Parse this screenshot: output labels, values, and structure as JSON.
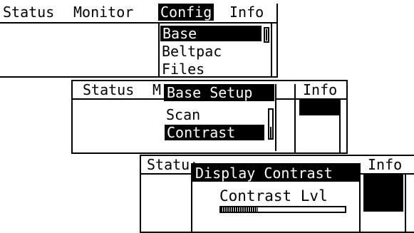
{
  "colors": {
    "foreground": "#000000",
    "background": "#ffffff"
  },
  "screen1": {
    "menubar": {
      "status": "Status",
      "monitor": "Monitor",
      "config": "Config",
      "info": "Info"
    },
    "config_menu": {
      "items": [
        "Base",
        "Beltpac",
        "Files"
      ],
      "selected": "Base"
    }
  },
  "screen2": {
    "menubar": {
      "status": "Status",
      "monitor_partial": "M",
      "info": "Info"
    },
    "base_setup_menu": {
      "title": "Base Setup",
      "items": [
        "Scan",
        "Contrast"
      ],
      "selected": "Contrast"
    }
  },
  "screen3": {
    "menubar": {
      "status_partial": "Statu:",
      "info": "Info"
    },
    "display_contrast_dialog": {
      "title": "Display Contrast",
      "label": "Contrast Lvl",
      "level_fraction": 0.3
    }
  }
}
